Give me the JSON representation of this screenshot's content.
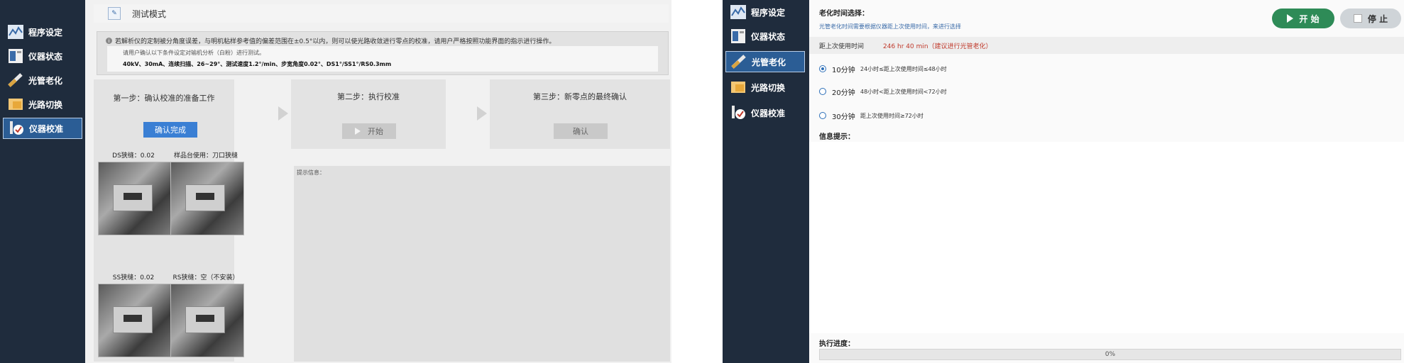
{
  "sidebar": {
    "items": [
      {
        "label": "程序设定",
        "icon": "chart-icon"
      },
      {
        "label": "仪器状态",
        "icon": "instrument-status-icon"
      },
      {
        "label": "光管老化",
        "icon": "tube-aging-icon"
      },
      {
        "label": "光路切换",
        "icon": "light-path-icon"
      },
      {
        "label": "仪器校准",
        "icon": "calibration-icon"
      }
    ]
  },
  "calibration": {
    "title": "测试模式",
    "notice_text": "若解析仪的定制被分角度误差，与明机粘样参考值的偏差范围在±0.5°以内，则可以使光路收敛进行零点的校准，请用户严格按照功能界面的指示进行操作。",
    "notice_sub": "请用户确认以下条件设定对输机分析（白粉）进行测试。",
    "notice_params": "40kV、30mA、连续扫描、26~29°、测试速度1.2°/min、步宽角度0.02°、DS1°/SS1°/RS0.3mm",
    "steps": [
      {
        "title": "第一步：确认校准的准备工作",
        "button": "确认完成"
      },
      {
        "title": "第二步：执行校准",
        "button": "开始"
      },
      {
        "title": "第三步：新零点的最终确认",
        "button": "确认"
      }
    ],
    "photos": [
      {
        "label": "DS狭缝：0.02"
      },
      {
        "label": "样品台使用：刀口狭缝"
      },
      {
        "label": "SS狭缝：0.02"
      },
      {
        "label": "RS狭缝：空（不安装）"
      }
    ],
    "message_label": "提示信息："
  },
  "aging": {
    "section_title": "老化时间选择：",
    "hint": "光管老化时间需要根据仪器距上次使用时间，来进行选择",
    "start_label": "开 始",
    "stop_label": "停 止",
    "last_use_label": "距上次使用时间",
    "last_use_value": "246 hr  40 min（建议进行光管老化）",
    "options": [
      {
        "label": "10分钟",
        "desc": "24小时≤距上次使用时间≤48小时",
        "selected": true
      },
      {
        "label": "20分钟",
        "desc": "48小时<距上次使用时间<72小时",
        "selected": false
      },
      {
        "label": "30分钟",
        "desc": "距上次使用时间≥72小时",
        "selected": false
      }
    ],
    "info_label": "信息提示：",
    "progress_label": "执行进度：",
    "progress_value": "0%",
    "progress_fraction": 0
  },
  "colors": {
    "sidebar_bg": "#1f2c3d",
    "accent_blue": "#3a7fd4",
    "start_green": "#2e8b57",
    "warning_red": "#c0392b"
  }
}
